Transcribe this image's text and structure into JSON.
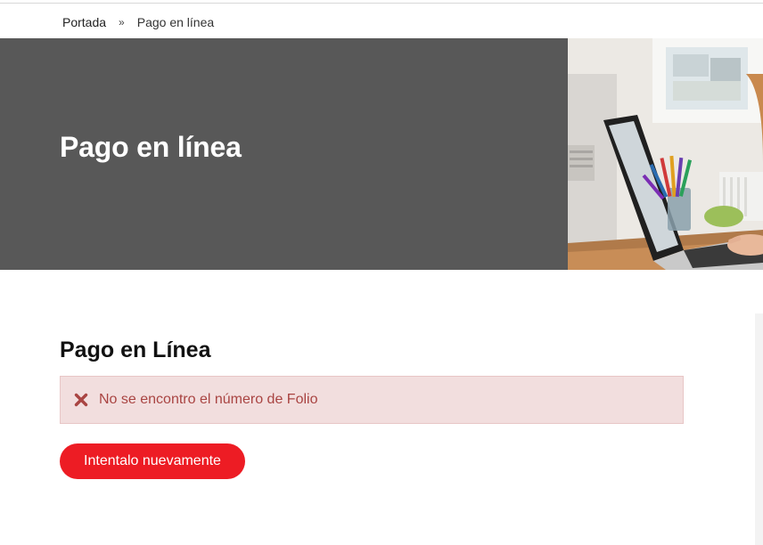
{
  "breadcrumb": {
    "home": "Portada",
    "separator": "»",
    "current": "Pago en línea"
  },
  "hero": {
    "title": "Pago en línea",
    "background_color": "#585858"
  },
  "main": {
    "title": "Pago en Línea",
    "alert": {
      "icon": "close-icon",
      "message": "No se encontro el número de Folio",
      "background_color": "#f2dede",
      "text_color": "#a94442"
    },
    "retry_button": {
      "label": "Intentalo nuevamente",
      "color": "#ed1c24"
    }
  }
}
